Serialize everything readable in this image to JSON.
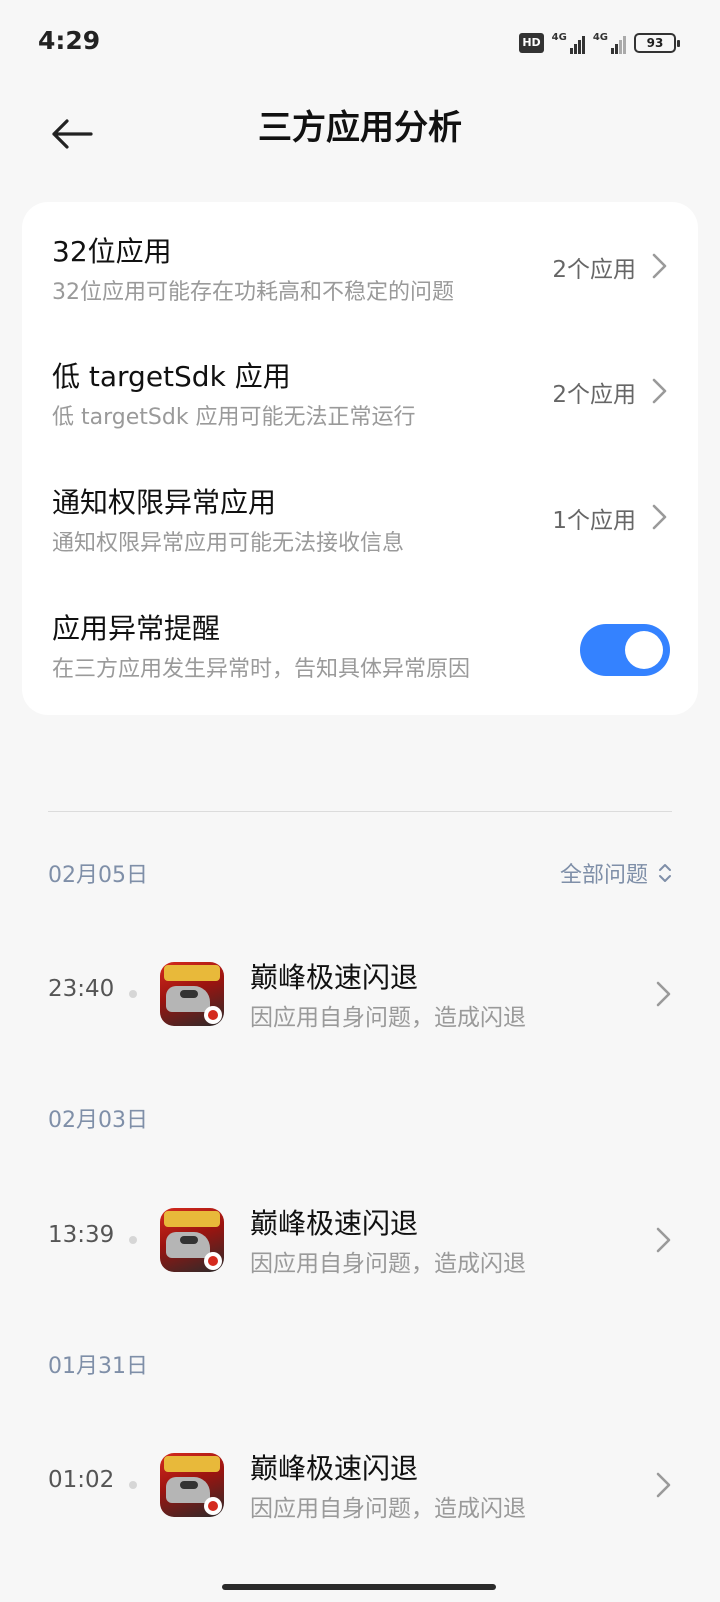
{
  "status_bar": {
    "time": "4:29",
    "hd_badge": "HD",
    "network_1": "4G",
    "network_2": "4G",
    "battery": "93"
  },
  "header": {
    "title": "三方应用分析",
    "back_icon": "arrow-left-icon"
  },
  "settings": {
    "items": [
      {
        "title": "32位应用",
        "subtitle": "32位应用可能存在功耗高和不稳定的问题",
        "value": "2个应用"
      },
      {
        "title": "低 targetSdk 应用",
        "subtitle": "低 targetSdk 应用可能无法正常运行",
        "value": "2个应用"
      },
      {
        "title": "通知权限异常应用",
        "subtitle": "通知权限异常应用可能无法接收信息",
        "value": "1个应用"
      }
    ],
    "toggle_item": {
      "title": "应用异常提醒",
      "subtitle": "在三方应用发生异常时，告知具体异常原因",
      "enabled": true
    },
    "accent_color": "#3482ff"
  },
  "history": {
    "filter_label": "全部问题",
    "groups": [
      {
        "date": "02月05日",
        "entries": [
          {
            "time": "23:40",
            "app": "巅峰极速闪退",
            "reason": "因应用自身问题，造成闪退"
          }
        ]
      },
      {
        "date": "02月03日",
        "entries": [
          {
            "time": "13:39",
            "app": "巅峰极速闪退",
            "reason": "因应用自身问题，造成闪退"
          }
        ]
      },
      {
        "date": "01月31日",
        "entries": [
          {
            "time": "01:02",
            "app": "巅峰极速闪退",
            "reason": "因应用自身问题，造成闪退"
          }
        ]
      }
    ]
  }
}
